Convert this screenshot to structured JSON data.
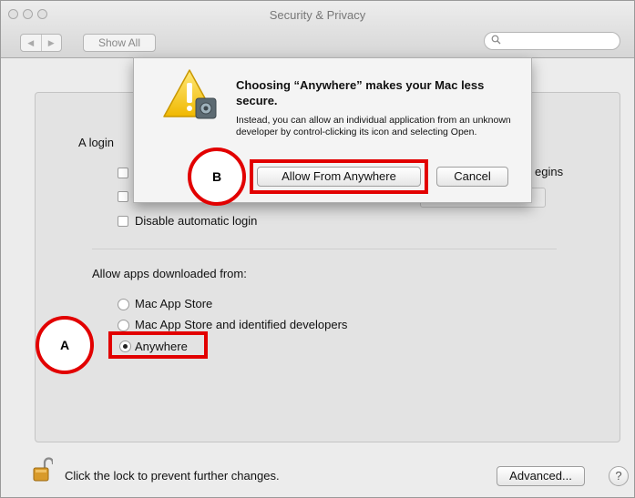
{
  "window": {
    "title": "Security & Privacy"
  },
  "toolbar": {
    "back_glyph": "◀",
    "forward_glyph": "▶",
    "show_all_label": "Show All",
    "search_placeholder": ""
  },
  "general": {
    "login_prefix": "A login",
    "gins_fragment": "egins",
    "disable_auto_login_label": "Disable automatic login",
    "allow_apps_label": "Allow apps downloaded from:",
    "options": [
      {
        "label": "Mac App Store",
        "selected": false
      },
      {
        "label": "Mac App Store and identified developers",
        "selected": false
      },
      {
        "label": "Anywhere",
        "selected": true
      }
    ]
  },
  "dialog": {
    "title": "Choosing “Anywhere” makes your Mac less secure.",
    "message": "Instead, you can allow an individual application from an unknown developer by control-clicking its icon and selecting Open.",
    "allow_button": "Allow From Anywhere",
    "cancel_button": "Cancel"
  },
  "footer": {
    "lock_text": "Click the lock to prevent further changes.",
    "advanced_button": "Advanced...",
    "help_glyph": "?"
  },
  "annotations": {
    "marker_a": "A",
    "marker_b": "B",
    "highlight_color": "#e20000"
  },
  "icons": {
    "warning": "warning-triangle-icon",
    "lock": "lock-icon",
    "search": "search-icon"
  }
}
